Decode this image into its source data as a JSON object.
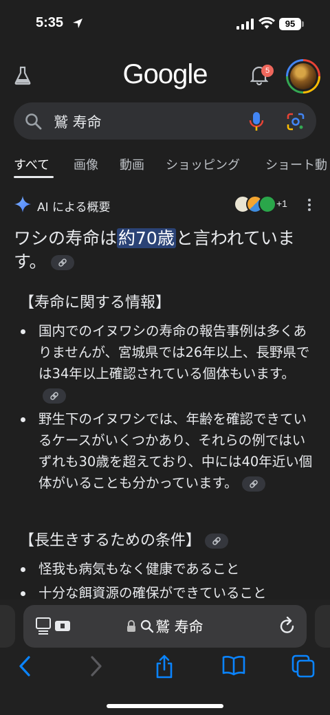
{
  "status": {
    "time": "5:35",
    "battery": "95"
  },
  "header": {
    "logo": "Google",
    "notification_count": "5"
  },
  "search": {
    "query": "鷲 寿命"
  },
  "tabs": [
    "すべて",
    "画像",
    "動画",
    "ショッピング",
    "ショート動"
  ],
  "ai_overview": {
    "title": "AI による概要",
    "sources_more": "+1",
    "answer_before": "ワシの寿命は",
    "answer_highlight": "約70歳",
    "answer_after": "と言われています。",
    "section1_title": "【寿命に関する情報】",
    "section1_bullets": [
      "国内でのイヌワシの寿命の報告事例は多くありませんが、宮城県では26年以上、長野県では34年以上確認されている個体もいます。",
      "野生下のイヌワシでは、年齢を確認できているケースがいくつかあり、それらの例ではいずれも30歳を超えており、中には40年近い個体がいることも分かっています。"
    ],
    "section2_title": "【長生きするための条件】",
    "section2_bullets": [
      "怪我も病気もなく健康であること",
      "十分な餌資源の確保ができていること"
    ]
  },
  "browser": {
    "url_text": "鷲 寿命"
  },
  "colors": {
    "background": "#1f1f1f",
    "highlight": "#2b4376",
    "accent_blue": "#0a84ff"
  }
}
